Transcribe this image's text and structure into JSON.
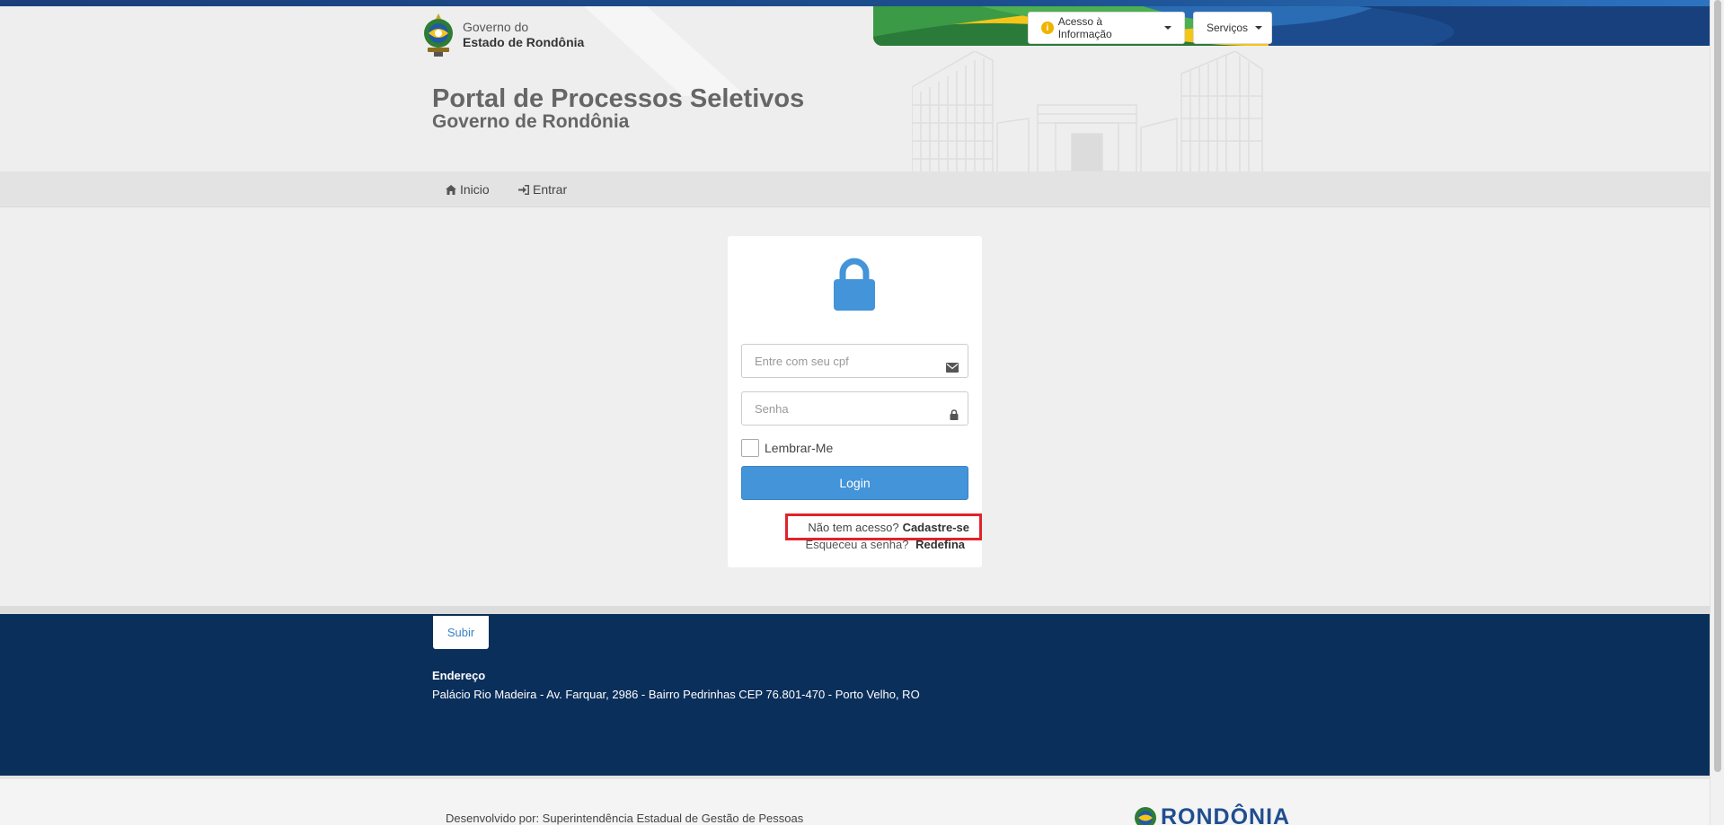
{
  "header": {
    "logo_line1": "Governo do",
    "logo_line2": "Estado de Rondônia",
    "acesso_label": "Acesso à Informação",
    "servicos_label": "Serviços",
    "title": "Portal de Processos Seletivos",
    "subtitle": "Governo de Rondônia"
  },
  "nav": {
    "home_label": "Inicio",
    "entrar_label": "Entrar"
  },
  "login": {
    "cpf_placeholder": "Entre com seu cpf",
    "senha_placeholder": "Senha",
    "remember_label": "Lembrar-Me",
    "login_button": "Login",
    "no_access_text": "Não tem acesso?",
    "register_link": "Cadastre-se",
    "forgot_text": "Esqueceu a senha?",
    "reset_link": "Redefina"
  },
  "footer": {
    "subir_label": "Subir",
    "address_label": "Endereço",
    "address_text": "Palácio Rio Madeira - Av. Farquar, 2986 - Bairro Pedrinhas CEP 76.801-470 - Porto Velho, RO",
    "developed_by": "Desenvolvido por: Superintendência Estadual de Gestão de Pessoas",
    "brand": "RONDÔNIA"
  },
  "icons": {
    "lock": "lock-icon",
    "envelope": "envelope-icon",
    "home": "home-icon",
    "sign_in": "sign-in-icon",
    "info": "info-icon"
  },
  "colors": {
    "primary": "#4394d8",
    "footer": "#0b2f5b",
    "highlight": "#e0232a"
  }
}
